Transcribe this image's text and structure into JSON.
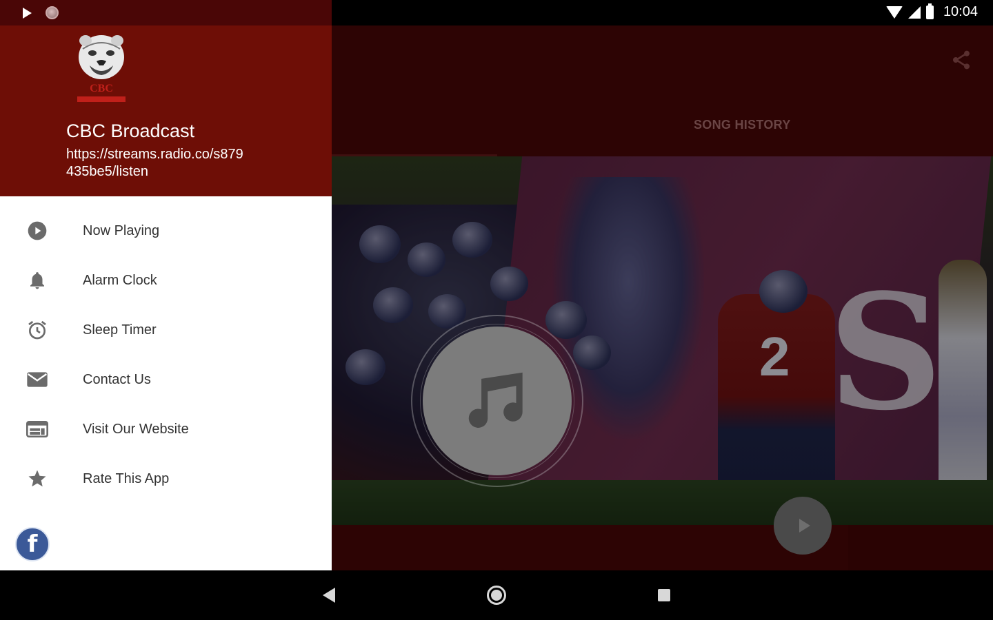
{
  "status_bar": {
    "time": "10:04"
  },
  "drawer": {
    "title": "CBC Broadcast",
    "url": "https://streams.radio.co/s879435be5/listen",
    "menu_items": [
      {
        "label": "Now Playing",
        "icon": "play-circle-icon"
      },
      {
        "label": "Alarm Clock",
        "icon": "bell-icon"
      },
      {
        "label": "Sleep Timer",
        "icon": "alarm-clock-icon"
      },
      {
        "label": "Contact Us",
        "icon": "mail-icon"
      },
      {
        "label": "Visit Our Website",
        "icon": "web-icon"
      },
      {
        "label": "Rate This App",
        "icon": "star-icon"
      }
    ],
    "social": {
      "icon": "facebook-icon",
      "glyph": "f"
    }
  },
  "main": {
    "tab_song_history": "SONG HISTORY"
  },
  "colors": {
    "drawer_header": "#6e0e06",
    "app_background": "#2d0404",
    "facebook": "#3b5998"
  }
}
